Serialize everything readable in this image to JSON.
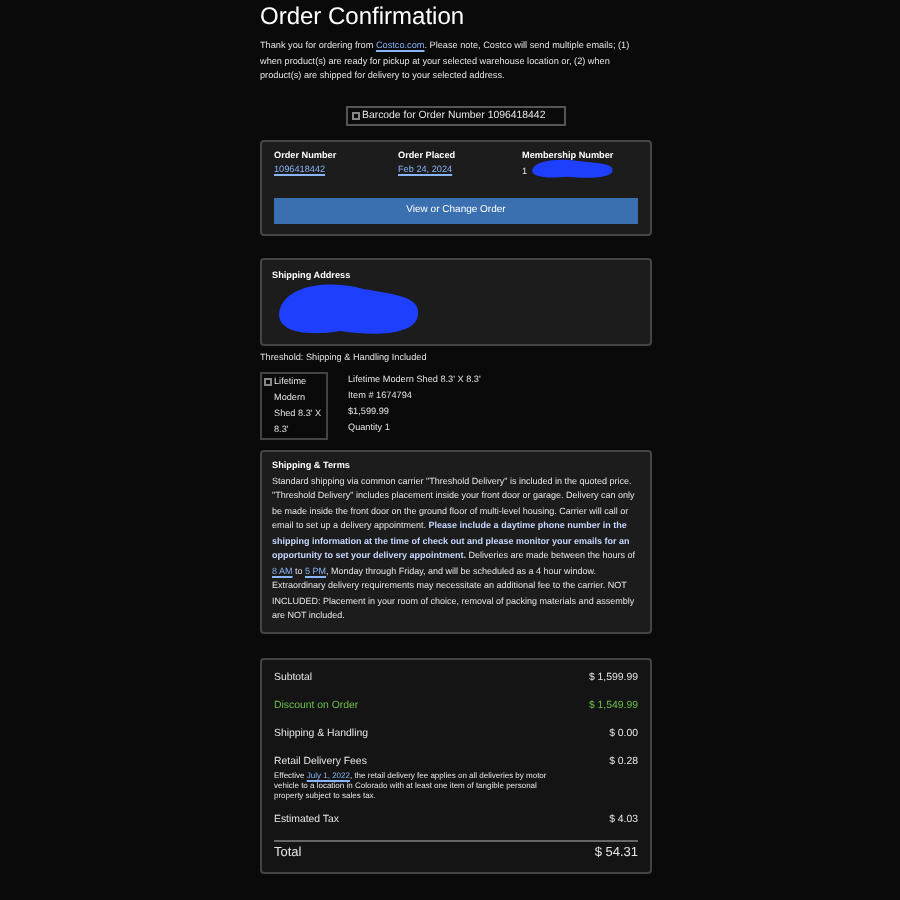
{
  "title": "Order Confirmation",
  "intro": [
    {
      "kind": "text",
      "text": "Thank you for ordering from "
    },
    {
      "kind": "link",
      "text": "Costco.com"
    },
    {
      "kind": "text",
      "text": ". Please note, Costco will send multiple emails; (1) when product(s) are ready for pickup at your selected warehouse location or, (2) when product(s) are shipped for delivery to your selected address."
    }
  ],
  "barcode": {
    "alt": "Barcode for Order Number 1096418442"
  },
  "order": {
    "fields": [
      {
        "label": "Order Number",
        "value": "1096418442",
        "kind": "link"
      },
      {
        "label": "Order Placed",
        "value": "Feb 24, 2024",
        "kind": "link"
      },
      {
        "label": "Membership Number",
        "value": "1",
        "kind": "redacted"
      }
    ],
    "button": "View or Change Order"
  },
  "shipping_address": {
    "label": "Shipping Address",
    "redacted": true
  },
  "threshold": "Threshold: Shipping & Handling Included",
  "product": {
    "image_alt": "Lifetime Modern Shed 8.3' X 8.3'",
    "lines": [
      "Lifetime Modern Shed 8.3' X 8.3'",
      "Item # 1674794",
      "$1,599.99",
      "Quantity 1"
    ]
  },
  "terms": {
    "title": "Shipping & Terms",
    "parts": [
      {
        "kind": "text",
        "text": "Standard shipping via common carrier \"Threshold Delivery\" is included in the quoted price. \"Threshold Delivery\" includes placement inside your front door or garage. Delivery can only be made inside the front door on the ground floor of multi-level housing. Carrier will call or email to set up a delivery appointment. "
      },
      {
        "kind": "bold",
        "text": "Please include a daytime phone number in the shipping information at the time of check out and please monitor your emails for an opportunity to set your delivery appointment."
      },
      {
        "kind": "text",
        "text": " Deliveries are made between the hours of "
      },
      {
        "kind": "link",
        "text": "8 AM"
      },
      {
        "kind": "text",
        "text": " to "
      },
      {
        "kind": "link",
        "text": "5 PM"
      },
      {
        "kind": "text",
        "text": ", Monday through Friday, and will be scheduled as a 4 hour window. Extraordinary delivery requirements may necessitate an additional fee to the carrier. NOT INCLUDED: Placement in your room of choice, removal of packing materials and assembly are NOT included."
      }
    ]
  },
  "totals": [
    {
      "label": "Subtotal",
      "value": "$ 1,599.99",
      "kind": "normal"
    },
    {
      "label": "Discount on Order",
      "value": "$ 1,549.99",
      "kind": "discount"
    },
    {
      "label": "Shipping & Handling",
      "value": "$ 0.00",
      "kind": "normal"
    },
    {
      "label": "Retail Delivery Fees",
      "value": "$ 0.28",
      "kind": "fee",
      "note": [
        {
          "kind": "text",
          "text": "Effective "
        },
        {
          "kind": "link",
          "text": "July 1, 2022"
        },
        {
          "kind": "text",
          "text": ", the retail delivery fee applies on all deliveries by motor vehicle to a location in Colorado with at least one item of tangible personal property subject to sales tax."
        }
      ]
    },
    {
      "label": "Estimated Tax",
      "value": "$ 4.03",
      "kind": "normal"
    },
    {
      "label": "Total",
      "value": "$ 54.31",
      "kind": "total"
    }
  ]
}
